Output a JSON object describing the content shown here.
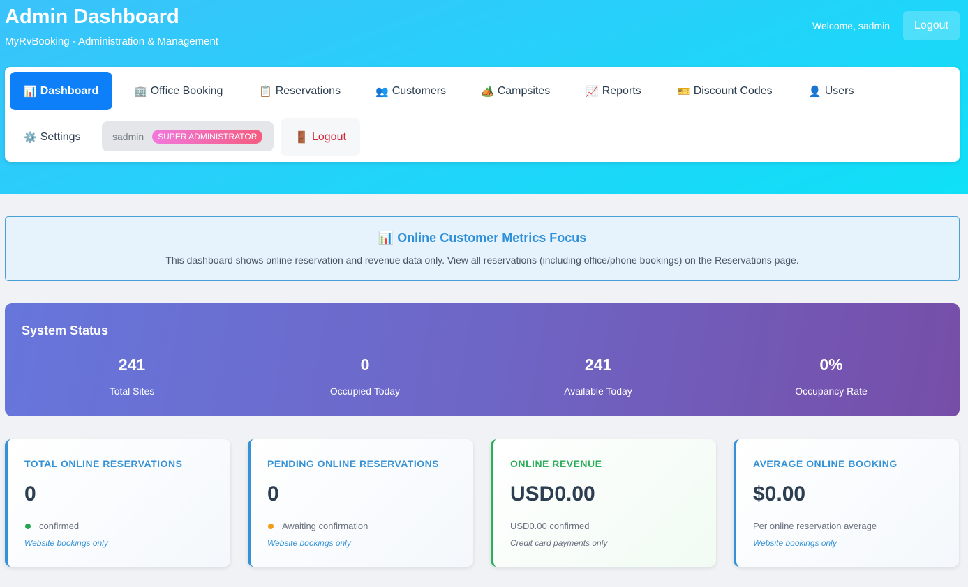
{
  "header": {
    "title": "Admin Dashboard",
    "subtitle": "MyRvBooking - Administration & Management",
    "welcome": "Welcome, sadmin",
    "logout_label": "Logout"
  },
  "nav": {
    "items": [
      {
        "icon": "📊",
        "icon_name": "bar-chart-icon",
        "label": "Dashboard"
      },
      {
        "icon": "🏢",
        "icon_name": "office-building-icon",
        "label": "Office Booking"
      },
      {
        "icon": "📋",
        "icon_name": "clipboard-icon",
        "label": "Reservations"
      },
      {
        "icon": "👥",
        "icon_name": "users-group-icon",
        "label": "Customers"
      },
      {
        "icon": "🏕️",
        "icon_name": "camping-icon",
        "label": "Campsites"
      },
      {
        "icon": "📈",
        "icon_name": "line-chart-icon",
        "label": "Reports"
      },
      {
        "icon": "🎫",
        "icon_name": "ticket-icon",
        "label": "Discount Codes"
      },
      {
        "icon": "👤",
        "icon_name": "user-icon",
        "label": "Users"
      },
      {
        "icon": "⚙️",
        "icon_name": "gear-icon",
        "label": "Settings"
      }
    ],
    "user": {
      "name": "sadmin",
      "role": "SUPER ADMINISTRATOR"
    },
    "logout": {
      "icon": "🚪",
      "icon_name": "door-icon",
      "label": "Logout"
    }
  },
  "info": {
    "icon": "📊",
    "title": "Online Customer Metrics Focus",
    "text": "This dashboard shows online reservation and revenue data only. View all reservations (including office/phone bookings) on the Reservations page."
  },
  "status": {
    "title": "System Status",
    "stats": [
      {
        "value": "241",
        "label": "Total Sites"
      },
      {
        "value": "0",
        "label": "Occupied Today"
      },
      {
        "value": "241",
        "label": "Available Today"
      },
      {
        "value": "0%",
        "label": "Occupancy Rate"
      }
    ]
  },
  "cards": [
    {
      "title": "TOTAL ONLINE RESERVATIONS",
      "value": "0",
      "sub": "confirmed",
      "dot_color": "#22a652",
      "note": "Website bookings only"
    },
    {
      "title": "PENDING ONLINE RESERVATIONS",
      "value": "0",
      "sub": "Awaiting confirmation",
      "dot_color": "#f39c12",
      "note": "Website bookings only"
    },
    {
      "title": "ONLINE REVENUE",
      "value": "USD0.00",
      "sub": "USD0.00 confirmed",
      "note": "Credit card payments only"
    },
    {
      "title": "AVERAGE ONLINE BOOKING",
      "value": "$0.00",
      "sub": "Per online reservation average",
      "note": "Website bookings only"
    }
  ],
  "colors": {
    "accent": "#0d7ff8",
    "info_blue": "#3592d6",
    "success": "#2cae5b",
    "danger": "#d0283a"
  }
}
